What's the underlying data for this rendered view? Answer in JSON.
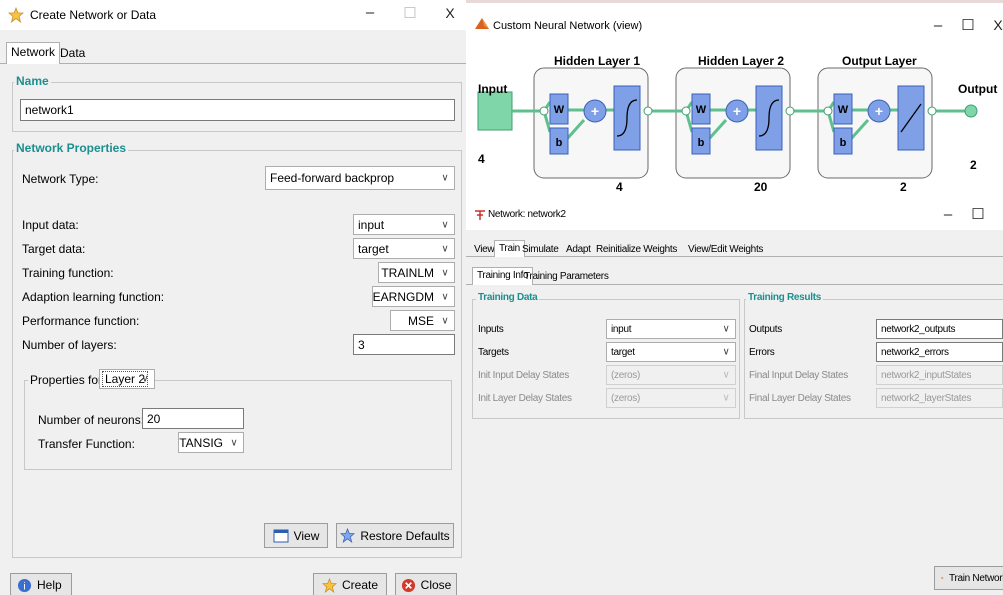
{
  "create_window": {
    "title": "Create Network or Data",
    "tabs": [
      "Network",
      "Data"
    ],
    "name_group": {
      "label": "Name",
      "value": "network1"
    },
    "props_group": {
      "label": "Network Properties",
      "network_type_label": "Network Type:",
      "network_type_value": "Feed-forward backprop",
      "rows": [
        {
          "label": "Input data:",
          "value": "input"
        },
        {
          "label": "Target data:",
          "value": "target"
        },
        {
          "label": "Training function:",
          "value": "TRAINLM"
        },
        {
          "label": "Adaption learning function:",
          "value": "LEARNGDM"
        },
        {
          "label": "Performance function:",
          "value": "MSE"
        },
        {
          "label": "Number of layers:",
          "value": "3"
        }
      ],
      "properties_for_label": "Properties for:",
      "properties_for_value": "Layer 2",
      "neurons_label": "Number of neurons:",
      "neurons_value": "20",
      "transfer_label": "Transfer Function:",
      "transfer_value": "TANSIG"
    },
    "view_button": "View",
    "restore_button": "Restore Defaults",
    "help_button": "Help",
    "create_button": "Create",
    "close_button": "Close"
  },
  "diagram_window": {
    "title": "Custom Neural Network (view)",
    "input_label": "Input",
    "input_size": "4",
    "output_label": "Output",
    "output_size": "2",
    "layers": [
      {
        "title": "Hidden Layer 1",
        "size": "4"
      },
      {
        "title": "Hidden Layer 2",
        "size": "20"
      },
      {
        "title": "Output Layer",
        "size": "2"
      }
    ],
    "w_label": "W",
    "b_label": "b",
    "plus_label": "+"
  },
  "network_window": {
    "title": "Network: network2",
    "menu_tabs": [
      "View",
      "Train",
      "Simulate",
      "Adapt",
      "Reinitialize Weights",
      "View/Edit Weights"
    ],
    "sub_tabs": [
      "Training Info",
      "Training Parameters"
    ],
    "training_data": {
      "label": "Training Data",
      "rows": [
        {
          "label": "Inputs",
          "value": "input"
        },
        {
          "label": "Targets",
          "value": "target"
        },
        {
          "label": "Init Input Delay States",
          "value": "(zeros)"
        },
        {
          "label": "Init Layer Delay States",
          "value": "(zeros)"
        }
      ]
    },
    "training_results": {
      "label": "Training Results",
      "rows": [
        {
          "label": "Outputs",
          "value": "network2_outputs"
        },
        {
          "label": "Errors",
          "value": "network2_errors"
        },
        {
          "label": "Final Input Delay States",
          "value": "network2_inputStates"
        },
        {
          "label": "Final Layer Delay States",
          "value": "network2_layerStates"
        }
      ]
    },
    "train_button": "Train Network"
  },
  "window_controls": {
    "minimize": "–",
    "maximize": "☐",
    "close": "X"
  },
  "colors": {
    "accent_teal": "#1c8f8f",
    "block_blue": "#7f9fe6",
    "input_green": "#7fd6a8",
    "link_green": "#5fbf8f"
  }
}
